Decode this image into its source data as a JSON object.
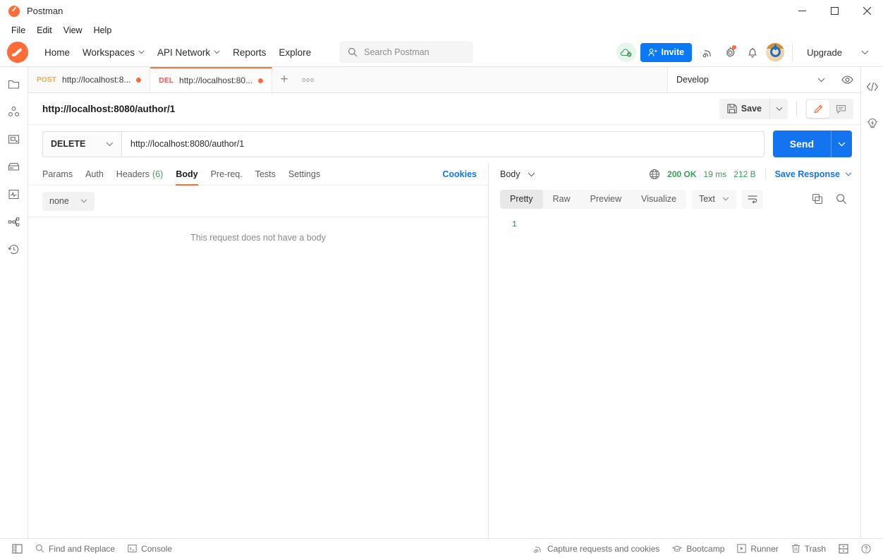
{
  "window": {
    "title": "Postman",
    "controls": {
      "minimize": "minimize-icon",
      "maximize": "maximize-icon",
      "close": "close-icon"
    }
  },
  "menubar": {
    "items": [
      "File",
      "Edit",
      "View",
      "Help"
    ]
  },
  "header": {
    "nav": [
      {
        "label": "Home",
        "caret": false
      },
      {
        "label": "Workspaces",
        "caret": true
      },
      {
        "label": "API Network",
        "caret": true
      },
      {
        "label": "Reports",
        "caret": false
      },
      {
        "label": "Explore",
        "caret": false
      }
    ],
    "search": {
      "placeholder": "Search Postman"
    },
    "invite_label": "Invite",
    "upgrade_label": "Upgrade"
  },
  "tabs": {
    "items": [
      {
        "method": "POST",
        "name": "http://localhost:8...",
        "dirty": true,
        "active": false
      },
      {
        "method": "DEL",
        "name": "http://localhost:80...",
        "dirty": true,
        "active": true
      }
    ],
    "new_tab": "+",
    "more": "ooo",
    "environment": "Develop"
  },
  "request": {
    "title": "http://localhost:8080/author/1",
    "save_label": "Save",
    "method": "DELETE",
    "url": "http://localhost:8080/author/1",
    "send_label": "Send",
    "tabs": [
      {
        "label": "Params",
        "count": "",
        "active": false
      },
      {
        "label": "Auth",
        "count": "",
        "active": false
      },
      {
        "label": "Headers",
        "count": "(6)",
        "active": false
      },
      {
        "label": "Body",
        "count": "",
        "active": true
      },
      {
        "label": "Pre-req.",
        "count": "",
        "active": false
      },
      {
        "label": "Tests",
        "count": "",
        "active": false
      },
      {
        "label": "Settings",
        "count": "",
        "active": false
      }
    ],
    "cookies_label": "Cookies",
    "body_type": "none",
    "body_empty_text": "This request does not have a body"
  },
  "response": {
    "view_label": "Body",
    "status": "200 OK",
    "time": "19 ms",
    "size": "212 B",
    "save_response_label": "Save Response",
    "format_tabs": [
      {
        "label": "Pretty",
        "active": true
      },
      {
        "label": "Raw",
        "active": false
      },
      {
        "label": "Preview",
        "active": false
      },
      {
        "label": "Visualize",
        "active": false
      }
    ],
    "language": "Text",
    "lines": [
      {
        "n": "1",
        "text": ""
      }
    ]
  },
  "statusbar": {
    "left": [
      {
        "label": "Find and Replace",
        "icon": "search-icon"
      },
      {
        "label": "Console",
        "icon": "console-icon"
      }
    ],
    "right": [
      {
        "label": "Capture requests and cookies",
        "icon": "capture-icon"
      },
      {
        "label": "Bootcamp",
        "icon": "bootcamp-icon"
      },
      {
        "label": "Runner",
        "icon": "runner-icon"
      },
      {
        "label": "Trash",
        "icon": "trash-icon"
      }
    ]
  },
  "sidebar": {
    "items": [
      {
        "name": "collections",
        "icon": "collections-icon"
      },
      {
        "name": "apis",
        "icon": "apis-icon"
      },
      {
        "name": "environments",
        "icon": "environments-icon"
      },
      {
        "name": "mock-servers",
        "icon": "mock-servers-icon"
      },
      {
        "name": "monitors",
        "icon": "monitors-icon"
      },
      {
        "name": "flows",
        "icon": "flows-icon"
      },
      {
        "name": "history",
        "icon": "history-icon"
      }
    ]
  },
  "colors": {
    "accent": "#ff6c37",
    "primary": "#1374ef",
    "success": "#3c9d58",
    "link": "#1374ef"
  }
}
